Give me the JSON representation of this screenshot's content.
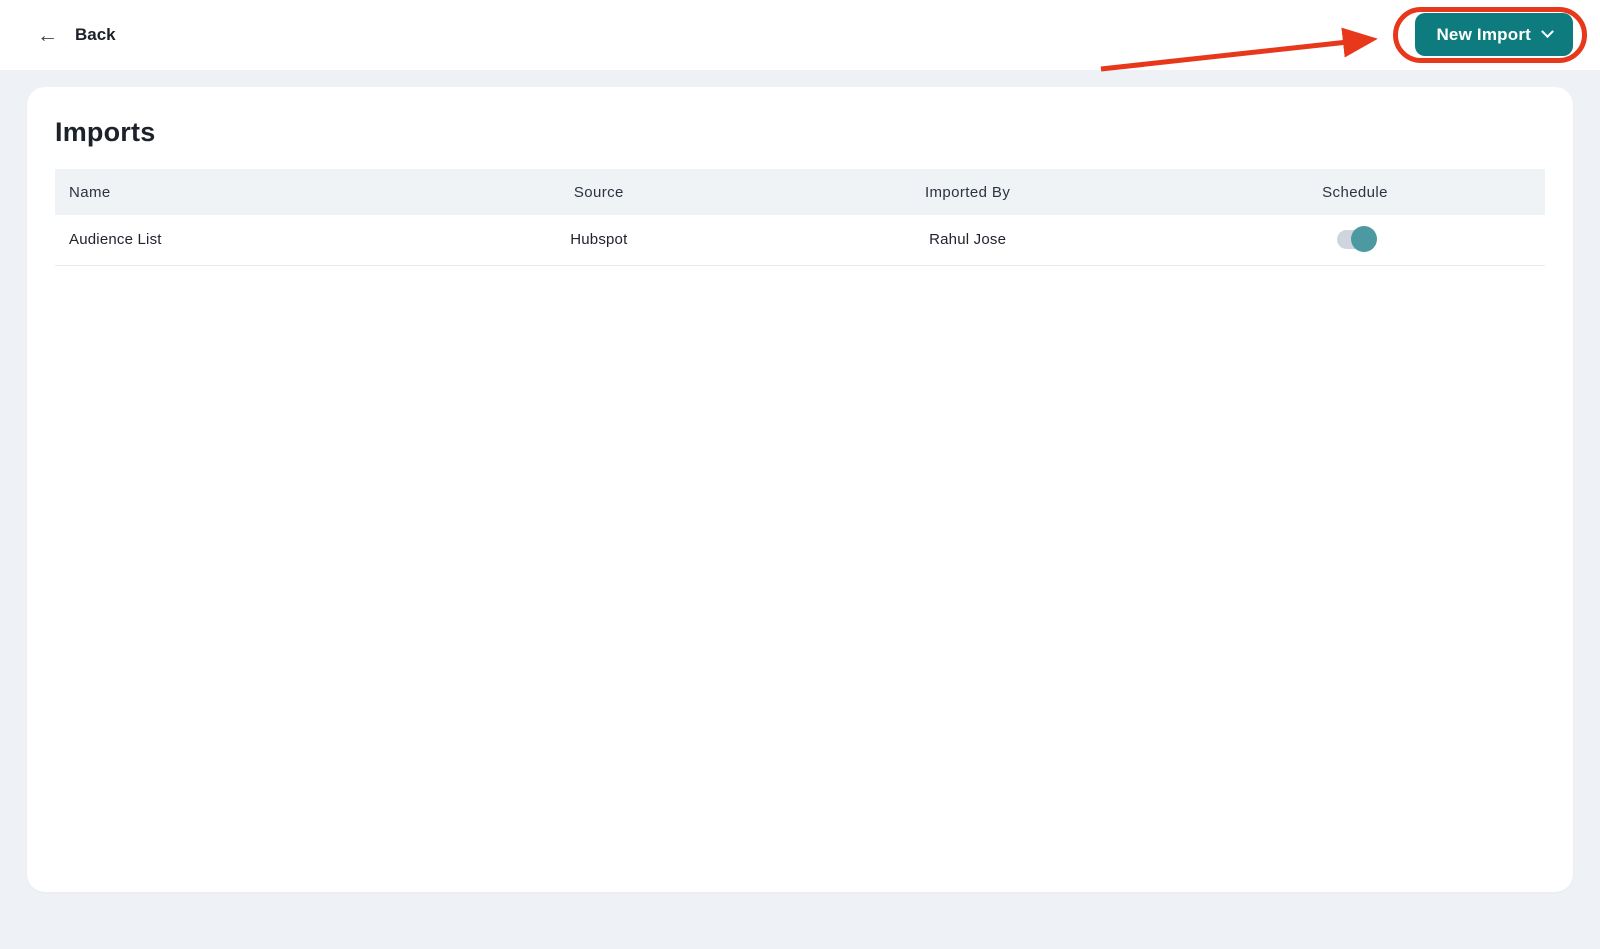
{
  "header": {
    "back": {
      "label": "Back"
    },
    "new_import": {
      "label": "New Import"
    }
  },
  "main": {
    "title": "Imports",
    "table": {
      "columns": [
        {
          "key": "name",
          "label": "Name"
        },
        {
          "key": "source",
          "label": "Source"
        },
        {
          "key": "imported_by",
          "label": "Imported By"
        },
        {
          "key": "schedule",
          "label": "Schedule"
        }
      ],
      "rows": [
        {
          "name": "Audience List",
          "source": "Hubspot",
          "imported_by": "Rahul Jose",
          "schedule_enabled": true
        }
      ]
    }
  },
  "icons": {
    "back_arrow": "←",
    "chevron_down": "chevron-down",
    "toggle_on": "toggle-on"
  },
  "annotation": {
    "type": "red-circle-and-arrow",
    "target": "new-import-button"
  },
  "colors": {
    "accent_teal": "#0E7C7E",
    "toggle_knob_teal": "#4C99A1",
    "toggle_track_gray": "#CFD5DF",
    "annotation_red": "#E8381B",
    "page_background": "#EEF1F5",
    "table_header_background": "#F0F3F6",
    "text_dark": "#1D212A"
  }
}
